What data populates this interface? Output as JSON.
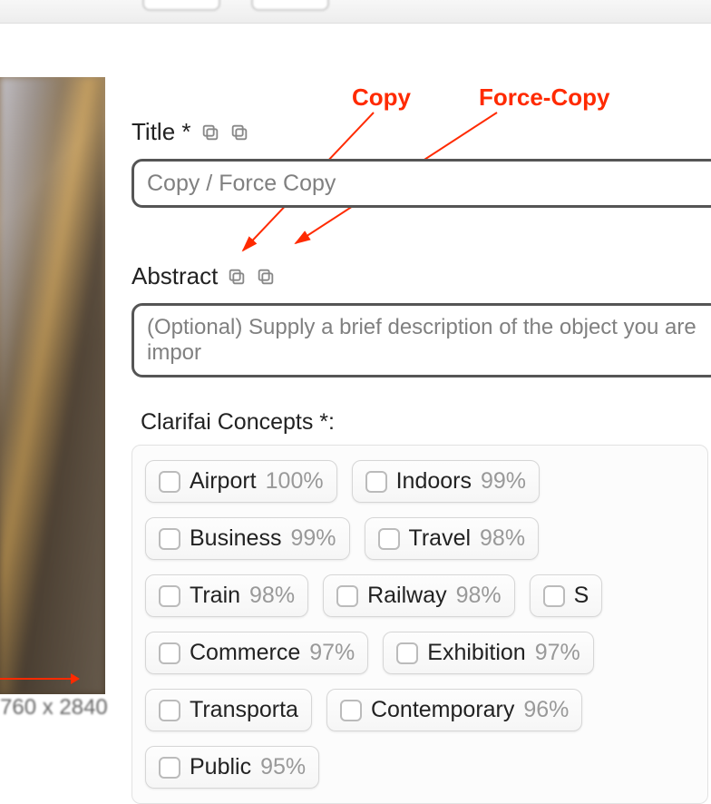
{
  "annotations": {
    "copy_label": "Copy",
    "force_copy_label": "Force-Copy"
  },
  "title_field": {
    "label": "Title *",
    "value": "Copy / Force Copy"
  },
  "abstract_field": {
    "label": "Abstract",
    "placeholder": "(Optional) Supply a brief description of the object you are impor"
  },
  "concepts": {
    "label": "Clarifai Concepts *:",
    "items": [
      {
        "label": "Airport",
        "pct": "100%"
      },
      {
        "label": "Indoors",
        "pct": "99%"
      },
      {
        "label": "Business",
        "pct": "99%"
      },
      {
        "label": "Travel",
        "pct": "98%"
      },
      {
        "label": "Train",
        "pct": "98%"
      },
      {
        "label": "Railway",
        "pct": "98%"
      },
      {
        "label": "S",
        "pct": ""
      },
      {
        "label": "Commerce",
        "pct": "97%"
      },
      {
        "label": "Exhibition",
        "pct": "97%"
      },
      {
        "label": "Transporta",
        "pct": ""
      },
      {
        "label": "Contemporary",
        "pct": "96%"
      },
      {
        "label": "Public",
        "pct": "95%"
      }
    ]
  }
}
